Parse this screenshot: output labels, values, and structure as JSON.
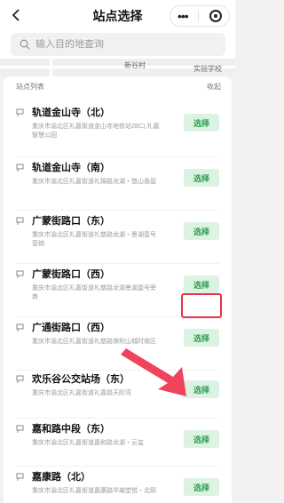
{
  "header": {
    "title": "站点选择"
  },
  "search": {
    "placeholder": "输入目的地查询"
  },
  "map": {
    "pois": [
      "新谷村",
      "实验学校"
    ]
  },
  "list": {
    "header_label": "站点列表",
    "collapse_label": "收起",
    "select_label": "选择",
    "stations": [
      {
        "name": "轨道金山寺（北）",
        "address": "重庆市渝北区礼嘉街道金山寺地铁站2B口,礼嘉智慧公园"
      },
      {
        "name": "轨道金山寺（南）",
        "address": "重庆市渝北区礼嘉街道礼锦路龙湖・悠山香庭"
      },
      {
        "name": "广蒙街路口（东）",
        "address": "重庆市渝北区礼嘉街道礼慈路龙湖・景湖壹号营销"
      },
      {
        "name": "广蒙街路口（西）",
        "address": "重庆市渝北区礼嘉街道礼慈路龙湖景湖壹号旁商"
      },
      {
        "name": "广通街路口（西）",
        "address": "重庆市渝北区礼嘉街道礼慈路保利山城时南区"
      },
      {
        "name": "欢乐谷公交站场（东）",
        "address": "重庆市渝北区礼嘉街道礼嘉路天阶湾"
      },
      {
        "name": "嘉和路中段（东）",
        "address": "重庆市渝北区礼嘉街道嘉和路龙湖・云玺"
      },
      {
        "name": "嘉康路（北）",
        "address": "重庆市渝北区礼嘉街道嘉康路华瀚堂悦・北熙"
      }
    ]
  },
  "colors": {
    "accent": "#2a9a4a",
    "highlight": "#e8334a"
  }
}
